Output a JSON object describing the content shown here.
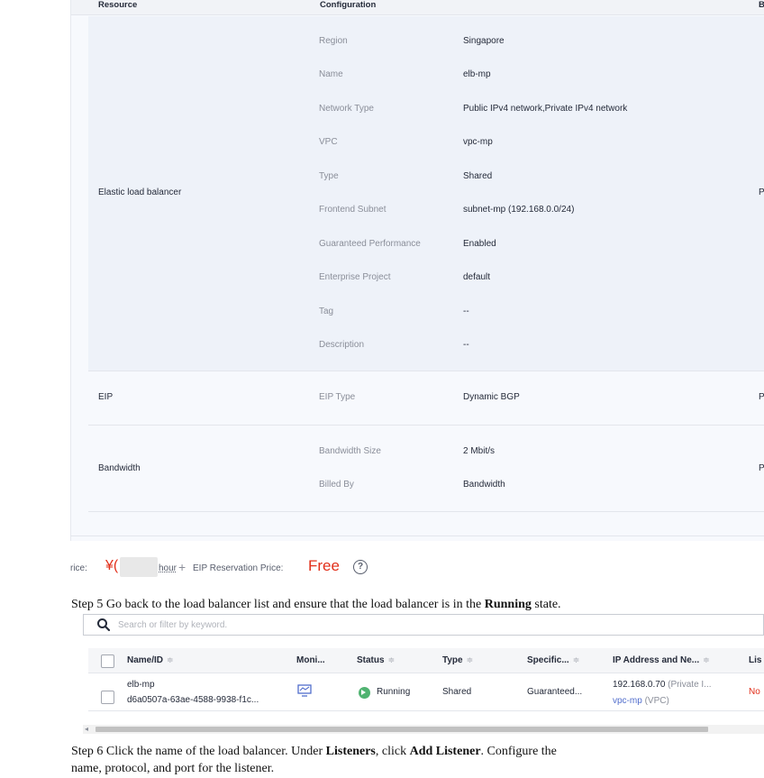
{
  "config_table": {
    "headers": {
      "resource": "Resource",
      "configuration": "Configuration",
      "billing": "B"
    },
    "sections": [
      {
        "resource": "Elastic load balancer",
        "right_letter": "P",
        "rows": [
          {
            "key": "Region",
            "value": "Singapore"
          },
          {
            "key": "Name",
            "value": "elb-mp"
          },
          {
            "key": "Network Type",
            "value": "Public IPv4 network,Private IPv4 network"
          },
          {
            "key": "VPC",
            "value": "vpc-mp"
          },
          {
            "key": "Type",
            "value": "Shared"
          },
          {
            "key": "Frontend Subnet",
            "value": "subnet-mp (192.168.0.0/24)"
          },
          {
            "key": "Guaranteed Performance",
            "value": "Enabled"
          },
          {
            "key": "Enterprise Project",
            "value": "default"
          },
          {
            "key": "Tag",
            "value": "--"
          },
          {
            "key": "Description",
            "value": "--"
          }
        ]
      },
      {
        "resource": "EIP",
        "right_letter": "P",
        "rows": [
          {
            "key": "EIP Type",
            "value": "Dynamic BGP"
          }
        ]
      },
      {
        "resource": "Bandwidth",
        "right_letter": "P",
        "rows": [
          {
            "key": "Bandwidth Size",
            "value": "2 Mbit/s"
          },
          {
            "key": "Billed By",
            "value": "Bandwidth"
          }
        ]
      }
    ]
  },
  "price": {
    "label": "rice:",
    "currency": "¥(",
    "unit": "hour",
    "plus": "+",
    "eip_label": "EIP Reservation Price:",
    "eip_value": "Free",
    "help": "?"
  },
  "steps": {
    "step5": {
      "prefix": "Step 5 Go back to the load balancer list and ensure that the load balancer is in the ",
      "bold": "Running",
      "suffix": " state."
    },
    "step6": {
      "p1": "Step 6 Click the name of the load balancer. Under ",
      "b1": "Listeners",
      "p2": ", click ",
      "b2": "Add Listener",
      "p3": ". Configure the",
      "line2": "name, protocol, and port for the listener."
    }
  },
  "search": {
    "placeholder": "Search or filter by keyword."
  },
  "lb_list": {
    "columns": [
      "Name/ID",
      "Moni...",
      "Status",
      "Type",
      "Specific...",
      "IP Address and Ne...",
      "Lis"
    ],
    "sort_glyph": "≑",
    "row": {
      "name": "elb-mp",
      "id": "d6a0507a-63ae-4588-9938-f1c...",
      "status": "Running",
      "type": "Shared",
      "spec": "Guaranteed...",
      "ip": "192.168.0.70",
      "ip_note": "(Private I...",
      "vpc": "vpc-mp",
      "vpc_note": "(VPC)",
      "listener": "No"
    }
  },
  "scrollbar": {
    "left_arrow": "◂"
  },
  "colors": {
    "price_red": "#e22f1a",
    "link": "#526ecc",
    "running_green": "#50b371"
  }
}
